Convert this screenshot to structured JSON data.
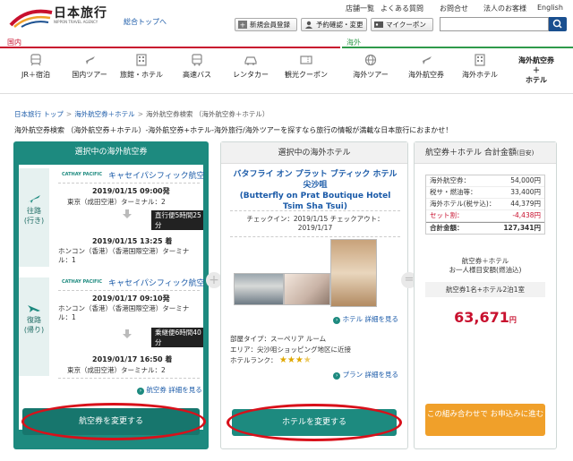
{
  "header": {
    "logo_text": "日本旅行",
    "logo_sub": "NIPPON TRAVEL AGENCY",
    "home_link": "総合トップへ",
    "top_links": [
      "店舗一覧",
      "よくある質問",
      "お問合せ",
      "法人のお客様",
      "English"
    ],
    "buttons": {
      "register": "新規会員登録",
      "history": "予約確認・変更",
      "coupon": "マイクーポン"
    },
    "search_placeholder": ""
  },
  "nav": {
    "domestic_label": "国内",
    "international_label": "海外",
    "domestic_items": [
      "JR＋宿泊",
      "国内ツアー",
      "旅館・ホテル",
      "高速バス",
      "レンタカー",
      "観光クーポン"
    ],
    "international_items": [
      "海外ツアー",
      "海外航空券",
      "海外ホテル",
      "海外航空券\n＋\nホテル"
    ]
  },
  "breadcrumb": {
    "items": [
      "日本旅行 トップ",
      "海外航空券＋ホテル",
      "海外航空券検索 （海外航空券＋ホテル）"
    ]
  },
  "page_title": "海外航空券検索 （海外航空券＋ホテル）-海外航空券+ホテル-海外旅行/海外ツアーを探すなら旅行の情報が満載な日本旅行におまかせ！",
  "flight_panel": {
    "title": "選択中の海外航空券",
    "outbound": {
      "label_top": "往路",
      "label_sub": "(行き)",
      "airline_logo": "CATHAY PACIFIC",
      "airline": "キャセイパシフィック航空",
      "dep_time": "2019/01/15 09:00発",
      "dep_place": "東京（成田空港）ターミナル：2",
      "duration": "直行便5時間25分",
      "arr_time": "2019/01/15 13:25 着",
      "arr_place": "ホンコン（香港）（香港国際空港）ターミナル：1"
    },
    "return": {
      "label_top": "復路",
      "label_sub": "(帰り)",
      "airline_logo": "CATHAY PACIFIC",
      "airline": "キャセイパシフィック航空",
      "dep_time": "2019/01/17 09:10発",
      "dep_place": "ホンコン（香港）（香港国際空港）ターミナル：1",
      "duration": "乗継便6時間40分",
      "arr_time": "2019/01/17 16:50 着",
      "arr_place": "東京（成田空港）ターミナル：2"
    },
    "detail_link": "航空券 詳細を見る",
    "change_button": "航空券を変更する"
  },
  "hotel_panel": {
    "title": "選択中の海外ホテル",
    "name_ja": "バタフライ オン プラット ブティック ホテル尖沙咀",
    "name_en": "(Butterfly on Prat Boutique Hotel Tsim Sha Tsui)",
    "dates": "チェックイン：2019/1/15 チェックアウト：2019/1/17",
    "detail_link": "ホテル 詳細を見る",
    "room_type": "部屋タイプ：スーペリア ルーム",
    "area": "エリア：尖沙咀ショッピング地区に近接",
    "rank_label": "ホテルランク：",
    "rank": 3.5,
    "plan_link": "プラン 詳細を見る",
    "change_button": "ホテルを変更する"
  },
  "total_panel": {
    "title": "航空券＋ホテル 合計金額",
    "title_suffix": "(目安)",
    "rows": [
      {
        "label": "海外航空券：",
        "value": "54,000円"
      },
      {
        "label": "税サ・燃油等：",
        "value": "33,400円"
      },
      {
        "label": "海外ホテル(税サ込)：",
        "value": "44,379円"
      },
      {
        "label": "セット割：",
        "value": "-4,438円"
      },
      {
        "label": "合計金額：",
        "value": "127,341円"
      }
    ],
    "note_line1": "航空券＋ホテル",
    "note_line2": "お一人様目安額(燃油込)",
    "people": "航空券1名+ホテル2泊1室",
    "price": "63,671",
    "price_unit": "円",
    "book_button": "この組み合わせで お申込みに進む"
  },
  "colors": {
    "brand_red": "#c8102e",
    "teal": "#1d8a7f",
    "orange": "#f0a02a",
    "annotation_red": "#d8101a"
  }
}
